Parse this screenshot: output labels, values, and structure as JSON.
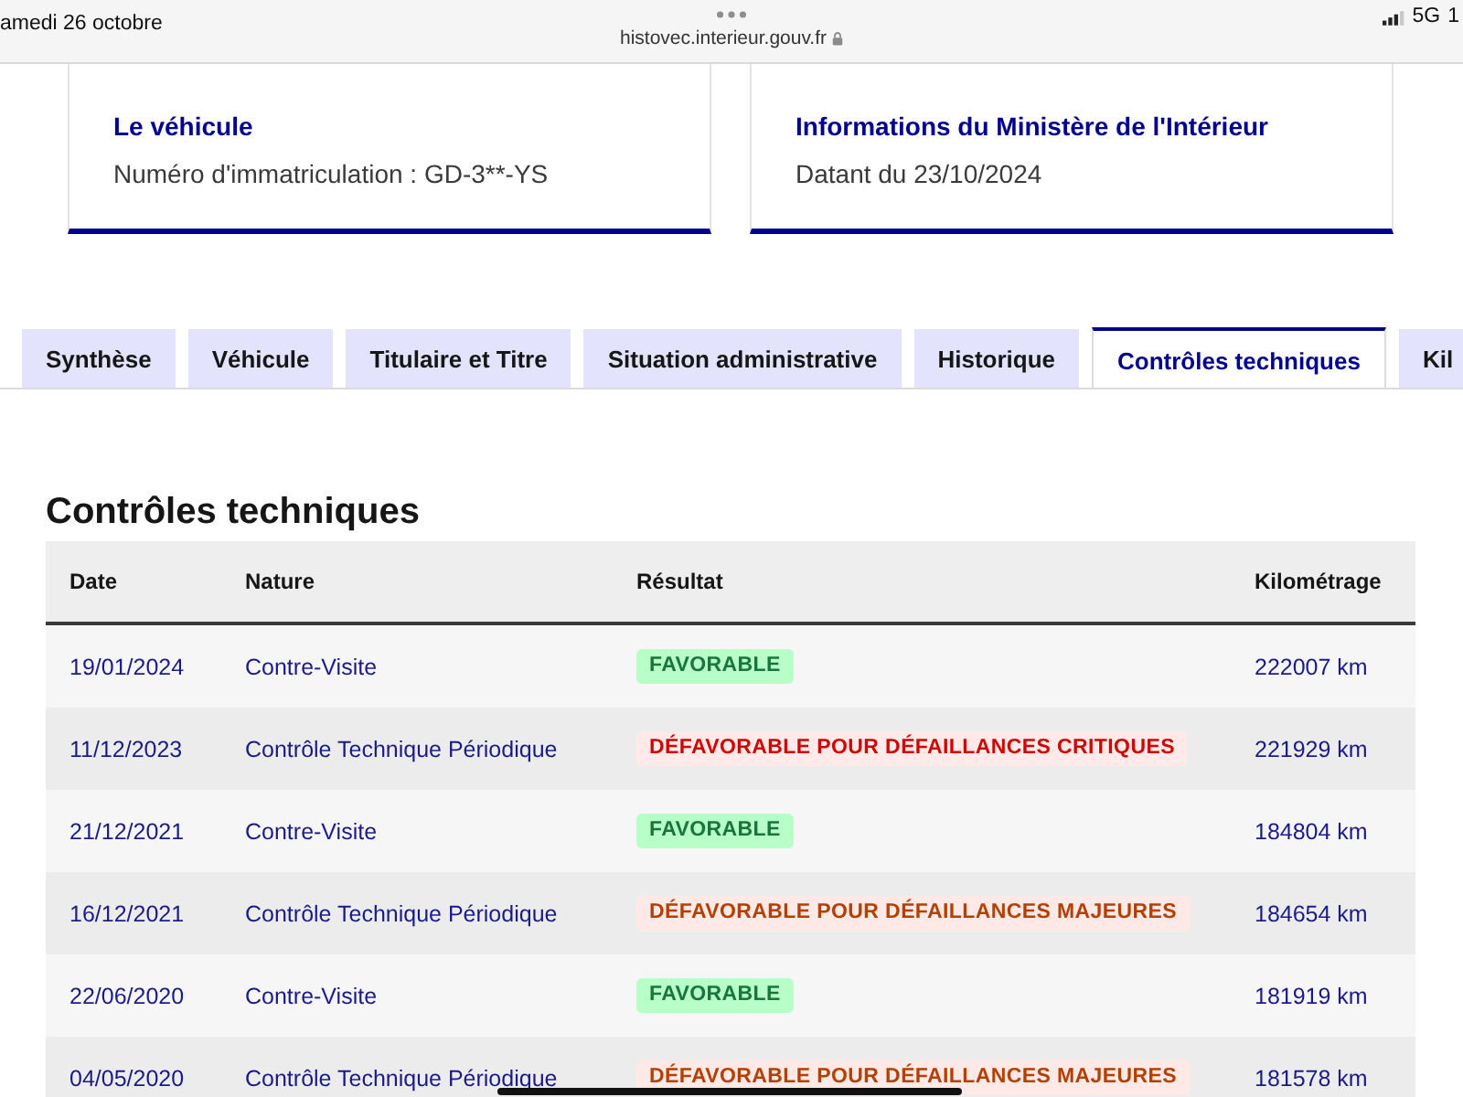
{
  "status_bar": {
    "date": "amedi 26 octobre",
    "url": "histovec.interieur.gouv.fr",
    "network": "5G",
    "battery": "1"
  },
  "cards": [
    {
      "title": "Le véhicule",
      "text": "Numéro d'immatriculation : GD-3**-YS"
    },
    {
      "title": "Informations du Ministère de l'Intérieur",
      "text": "Datant du 23/10/2024"
    }
  ],
  "tabs": [
    {
      "label": "Synthèse",
      "selected": false
    },
    {
      "label": "Véhicule",
      "selected": false
    },
    {
      "label": "Titulaire et Titre",
      "selected": false
    },
    {
      "label": "Situation administrative",
      "selected": false
    },
    {
      "label": "Historique",
      "selected": false
    },
    {
      "label": "Contrôles techniques",
      "selected": true
    },
    {
      "label": "Kil",
      "selected": false
    }
  ],
  "section": {
    "title": "Contrôles techniques"
  },
  "table": {
    "columns": [
      "Date",
      "Nature",
      "Résultat",
      "Kilométrage"
    ],
    "rows": [
      {
        "date": "19/01/2024",
        "nature": "Contre-Visite",
        "result": {
          "label": "FAVORABLE",
          "kind": "success"
        },
        "mileage": "222007 km"
      },
      {
        "date": "11/12/2023",
        "nature": "Contrôle Technique Périodique",
        "result": {
          "label": "DÉFAVORABLE POUR DÉFAILLANCES CRITIQUES",
          "kind": "error"
        },
        "mileage": "221929 km"
      },
      {
        "date": "21/12/2021",
        "nature": "Contre-Visite",
        "result": {
          "label": "FAVORABLE",
          "kind": "success"
        },
        "mileage": "184804 km"
      },
      {
        "date": "16/12/2021",
        "nature": "Contrôle Technique Périodique",
        "result": {
          "label": "DÉFAVORABLE POUR DÉFAILLANCES MAJEURES",
          "kind": "warning"
        },
        "mileage": "184654 km"
      },
      {
        "date": "22/06/2020",
        "nature": "Contre-Visite",
        "result": {
          "label": "FAVORABLE",
          "kind": "success"
        },
        "mileage": "181919 km"
      },
      {
        "date": "04/05/2020",
        "nature": "Contrôle Technique Périodique",
        "result": {
          "label": "DÉFAVORABLE POUR DÉFAILLANCES MAJEURES",
          "kind": "warning"
        },
        "mileage": "181578 km"
      }
    ]
  }
}
